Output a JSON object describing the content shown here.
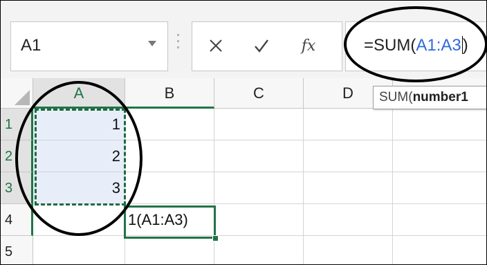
{
  "name_box": {
    "value": "A1"
  },
  "formula_bar": {
    "cancel_label": "✕",
    "enter_label": "✓",
    "fx_label": "fx",
    "formula_prefix": "=SUM(",
    "formula_ref": "A1:A3",
    "formula_suffix": ")"
  },
  "tooltip": {
    "func": "SUM(",
    "arg": "number1"
  },
  "columns": [
    "A",
    "B",
    "C",
    "D"
  ],
  "rows": [
    "1",
    "2",
    "3",
    "4",
    "5"
  ],
  "cells": {
    "a1": "1",
    "a2": "2",
    "a3": "3",
    "b4": "1(A1:A3)"
  },
  "colors": {
    "accent": "#217346",
    "reference_blue": "#2f6bd6",
    "copy_fill": "#e7eef9",
    "annotation": "#000000"
  },
  "icons": {
    "dropdown": "chevron-down-icon",
    "cancel": "close-icon",
    "enter": "checkmark-icon",
    "function": "function-icon"
  }
}
